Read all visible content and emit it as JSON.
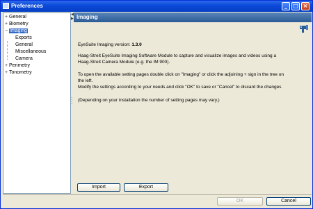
{
  "window": {
    "title": "Preferences",
    "controls": {
      "minimize": "_",
      "maximize": "□",
      "close": "×"
    }
  },
  "tree": {
    "items": [
      {
        "label": "General",
        "expander": "+"
      },
      {
        "label": "Biometry",
        "expander": "+"
      },
      {
        "label": "Imaging",
        "expander": "−",
        "selected": true
      },
      {
        "label": "Exports"
      },
      {
        "label": "General"
      },
      {
        "label": "Miscellaneous"
      },
      {
        "label": "Camera"
      },
      {
        "label": "Perimetry",
        "expander": "+"
      },
      {
        "label": "Tonometry",
        "expander": "+"
      }
    ]
  },
  "panel": {
    "header": "Imaging",
    "version_label": "EyeSuite Imaging version:",
    "version_value": "1.3.0",
    "description_1": "Haag-Streit EyeSuite Imaging Software Module to capture and visualize images and videos using a",
    "description_2": "Haag-Streit Camera Module (e.g. the IM 900).",
    "instructions_1": "To open the available setting pages double click on \"Imaging\" or click the adjoining + sign in the tree on",
    "instructions_2": "the left.",
    "instructions_3": "Modify the settings according to your needs and click \"OK\" to save or \"Cancel\" to discard the changes",
    "note": "(Depending on your installation the number of setting pages may vary.)"
  },
  "buttons": {
    "import": "Import",
    "export": "Export",
    "ok": "OK",
    "cancel": "Cancel"
  },
  "colors": {
    "titlebar": "#0a48d8",
    "header": "#3f6fa8",
    "selection": "#316ac5"
  }
}
